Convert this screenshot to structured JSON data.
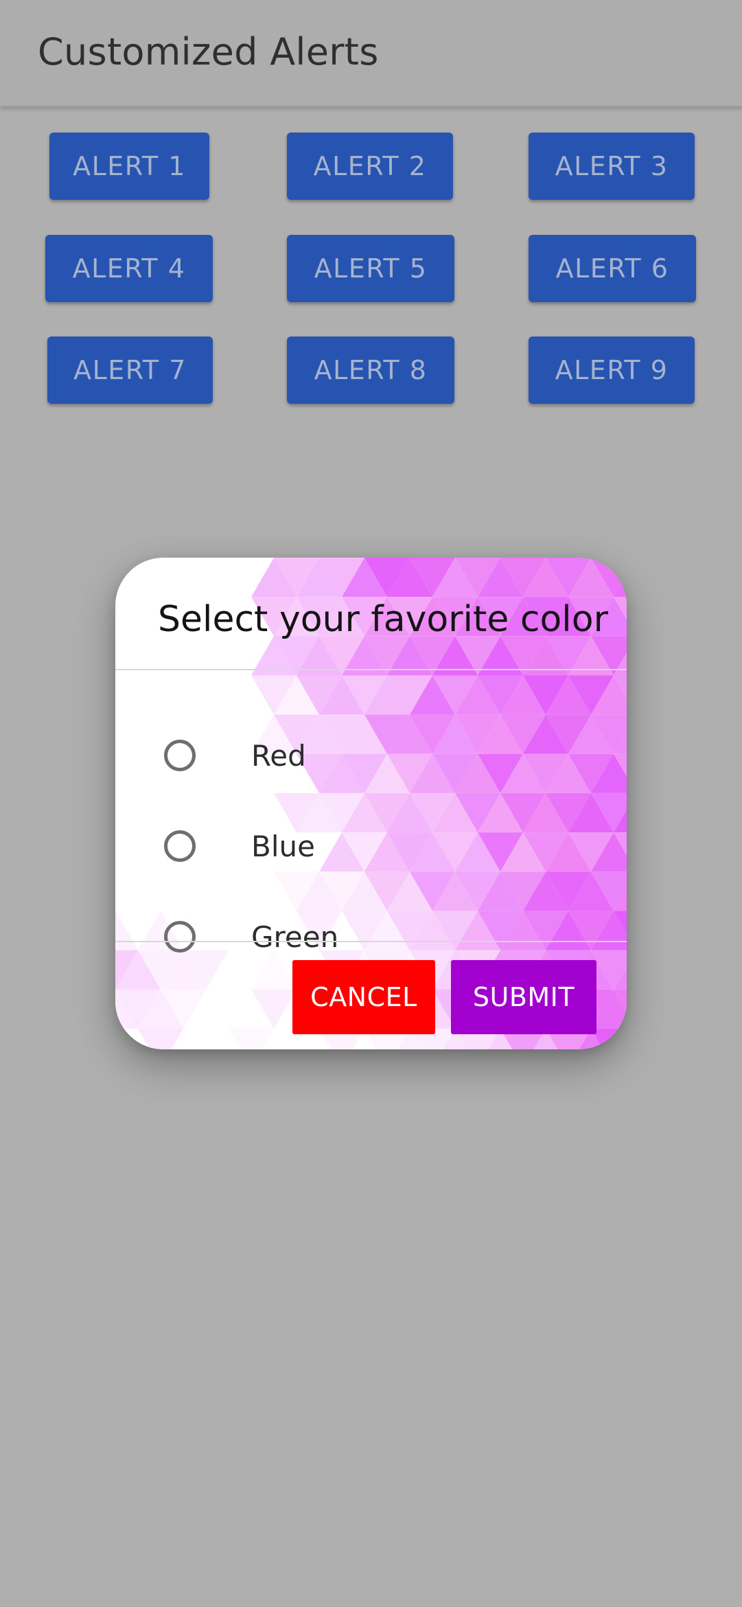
{
  "app_bar": {
    "title": "Customized Alerts"
  },
  "alert_buttons": [
    {
      "label": "ALERT 1"
    },
    {
      "label": "ALERT 2"
    },
    {
      "label": "ALERT 3"
    },
    {
      "label": "ALERT 4"
    },
    {
      "label": "ALERT 5"
    },
    {
      "label": "ALERT 6"
    },
    {
      "label": "ALERT 7"
    },
    {
      "label": "ALERT 8"
    },
    {
      "label": "ALERT 9"
    }
  ],
  "dialog": {
    "title": "Select your favorite color",
    "options": [
      {
        "label": "Red",
        "selected": false
      },
      {
        "label": "Blue",
        "selected": false
      },
      {
        "label": "Green",
        "selected": false
      }
    ],
    "cancel_label": "CANCEL",
    "submit_label": "SUBMIT"
  },
  "colors": {
    "alert_button": "#2654b0",
    "cancel_button": "#ff0000",
    "submit_button": "#a200cf",
    "background_pattern": "#f08cf4"
  }
}
